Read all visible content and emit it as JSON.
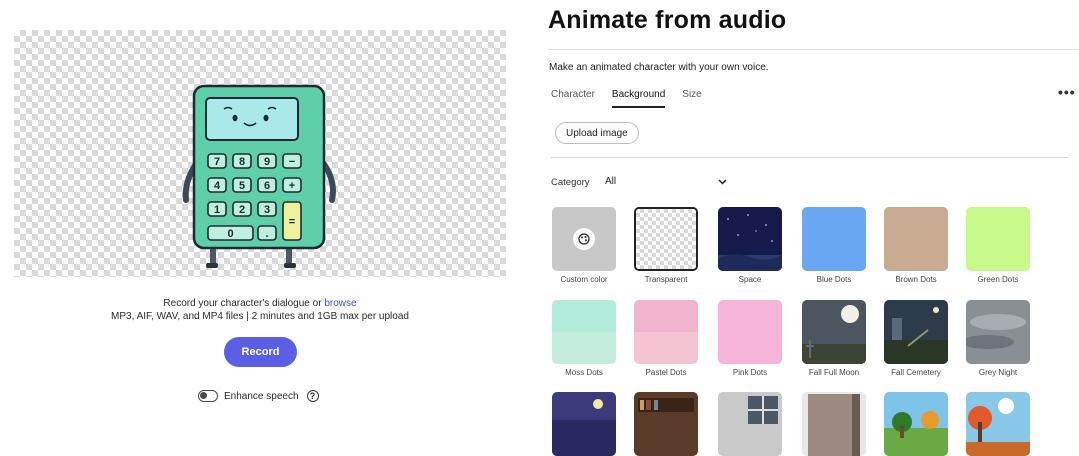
{
  "header": {
    "title": "Animate from audio",
    "subtitle": "Make an animated character with your own voice."
  },
  "tabs": [
    {
      "label": "Character",
      "active": false
    },
    {
      "label": "Background",
      "active": true
    },
    {
      "label": "Size",
      "active": false
    }
  ],
  "more_label": "•••",
  "upload_label": "Upload image",
  "category": {
    "label": "Category",
    "value": "All"
  },
  "stage": {
    "character": "calculator",
    "keys": [
      "7",
      "8",
      "9",
      "−",
      "4",
      "5",
      "6",
      "+",
      "1",
      "2",
      "3",
      "=",
      "0",
      "."
    ]
  },
  "record": {
    "prompt": "Record your character's dialogue or",
    "browse": "browse",
    "formats": "MP3, AIF, WAV, and MP4 files | 2 minutes and 1GB max per upload",
    "button": "Record",
    "enhance_label": "Enhance speech",
    "enhance_on": false,
    "help": "?"
  },
  "backgrounds": [
    {
      "label": "Custom color",
      "kind": "custom",
      "color": "#c8c8c8"
    },
    {
      "label": "Transparent",
      "kind": "transparent",
      "selected": true
    },
    {
      "label": "Space",
      "kind": "space"
    },
    {
      "label": "Blue Dots",
      "kind": "solid",
      "color": "#6aa7f2"
    },
    {
      "label": "Brown Dots",
      "kind": "solid",
      "color": "#c8ab91"
    },
    {
      "label": "Green Dots",
      "kind": "solid",
      "color": "#c8f98b"
    },
    {
      "label": "Moss Dots",
      "kind": "split",
      "color": "#b0ecd9",
      "color2": "#c4ecdc"
    },
    {
      "label": "Pastel Dots",
      "kind": "split",
      "color": "#f0b4ce",
      "color2": "#f4c4d2"
    },
    {
      "label": "Pink Dots",
      "kind": "solid",
      "color": "#f6b4d8"
    },
    {
      "label": "Fall Full Moon",
      "kind": "moon"
    },
    {
      "label": "Fall Cemetery",
      "kind": "cemetery"
    },
    {
      "label": "Grey Night",
      "kind": "grey"
    },
    {
      "kind": "purple-night"
    },
    {
      "kind": "bookshelf"
    },
    {
      "kind": "window"
    },
    {
      "kind": "door"
    },
    {
      "kind": "park"
    },
    {
      "kind": "autumn"
    }
  ]
}
